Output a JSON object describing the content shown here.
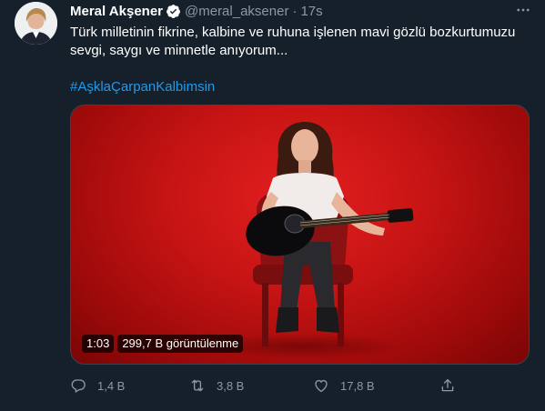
{
  "tweet": {
    "author_name": "Meral Akşener",
    "handle": "@meral_aksener",
    "separator": "·",
    "time": "17s",
    "text": "Türk milletinin fikrine, kalbine ve ruhuna işlenen mavi gözlü bozkurtumuzu sevgi, saygı ve minnetle anıyorum...",
    "hashtag": "#AşklaÇarpanKalbimsin",
    "verified": true
  },
  "video": {
    "duration": "1:03",
    "views": "299,7 B görüntülenme"
  },
  "actions": {
    "replies": "1,4 B",
    "retweets": "3,8 B",
    "likes": "17,8 B"
  },
  "colors": {
    "background": "#15202b",
    "accent": "#1d9bf0",
    "muted": "#8b98a5",
    "video_bg": "#d11a1a"
  },
  "icons": {
    "verified": "verified-badge-icon",
    "more": "more-horizontal-icon",
    "reply": "reply-icon",
    "retweet": "retweet-icon",
    "like": "heart-icon",
    "share": "share-icon"
  }
}
